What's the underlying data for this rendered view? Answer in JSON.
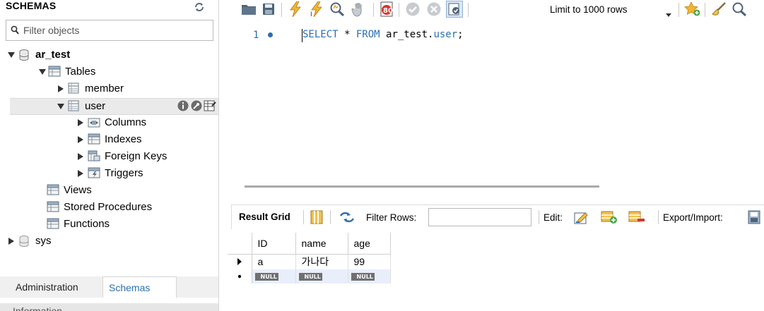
{
  "navigator": {
    "title": "SCHEMAS",
    "filter_placeholder": "Filter objects",
    "tree": {
      "schema_ar_test": "ar_test",
      "tables": "Tables",
      "table_member": "member",
      "table_user": "user",
      "columns": "Columns",
      "indexes": "Indexes",
      "foreign_keys": "Foreign Keys",
      "triggers": "Triggers",
      "views": "Views",
      "stored_procedures": "Stored Procedures",
      "functions": "Functions",
      "schema_sys": "sys"
    },
    "tabs": {
      "administration": "Administration",
      "schemas": "Schemas"
    },
    "info_label": "Information"
  },
  "toolbar": {
    "limit_value": "Limit to 1000 rows",
    "icons": [
      "open-folder-icon",
      "save-icon",
      "execute-icon",
      "execute-current-icon",
      "explain-icon",
      "stop-icon",
      "toggle-error-icon",
      "commit-icon",
      "rollback-icon",
      "autocommit-icon",
      "beautify-icon",
      "clear-icon"
    ]
  },
  "editor": {
    "line_number": "1",
    "code": {
      "kw1": "SELECT",
      "star": " * ",
      "kw2": "FROM",
      "table_prefix": " ar_test.",
      "table_name": "user",
      "semicolon": ";"
    }
  },
  "result": {
    "grid_label": "Result Grid",
    "filter_label": "Filter Rows:",
    "filter_value": "",
    "edit_label": "Edit:",
    "export_label": "Export/Import:",
    "columns": [
      "ID",
      "name",
      "age"
    ],
    "rows": [
      {
        "ID": "a",
        "name": "가나다",
        "age": "99"
      }
    ],
    "null_label": "NULL"
  },
  "colors": {
    "keyword": "#2a6fb3",
    "selection_row": "#eaeaea",
    "new_row": "#e9eefb"
  }
}
